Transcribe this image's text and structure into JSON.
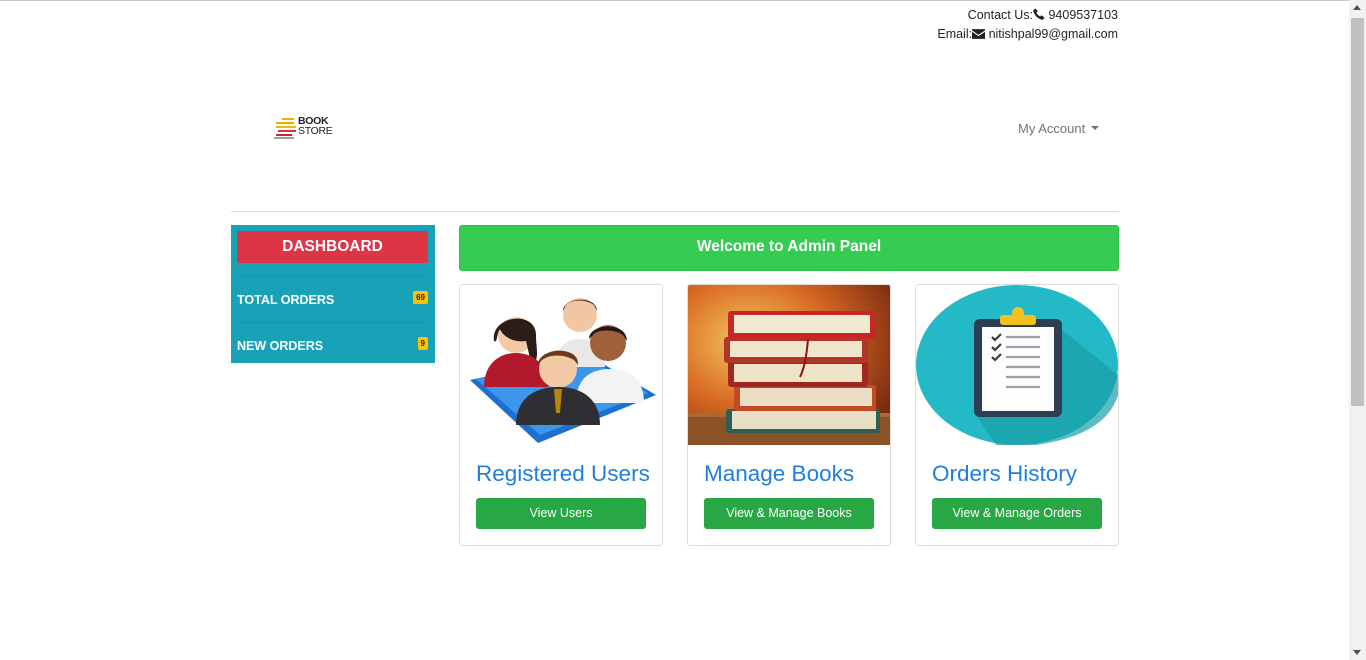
{
  "header": {
    "contact_label": "Contact Us:",
    "phone": "9409537103",
    "email_label": "Email:",
    "email": "nitishpal99@gmail.com"
  },
  "brand": {
    "line1": "BOOK",
    "line2": "STORE"
  },
  "nav": {
    "account_label": "My Account"
  },
  "sidebar": {
    "dashboard_label": "DASHBOARD",
    "items": [
      {
        "label": "TOTAL ORDERS",
        "count": "69"
      },
      {
        "label": "NEW ORDERS",
        "count": "9"
      }
    ]
  },
  "main": {
    "welcome": "Welcome to Admin Panel",
    "cards": [
      {
        "title": "Registered Users",
        "button": "View Users",
        "icon": "users-group-icon"
      },
      {
        "title": "Manage Books",
        "button": "View & Manage Books",
        "icon": "book-stack-icon"
      },
      {
        "title": "Orders History",
        "button": "View & Manage Orders",
        "icon": "clipboard-checklist-icon"
      }
    ]
  },
  "colors": {
    "sidebar": "#17a2b8",
    "dashboard": "#dc3545",
    "welcome": "#36cc52",
    "button": "#28a745",
    "badge": "#ffc107",
    "card_title": "#1e7fde"
  }
}
